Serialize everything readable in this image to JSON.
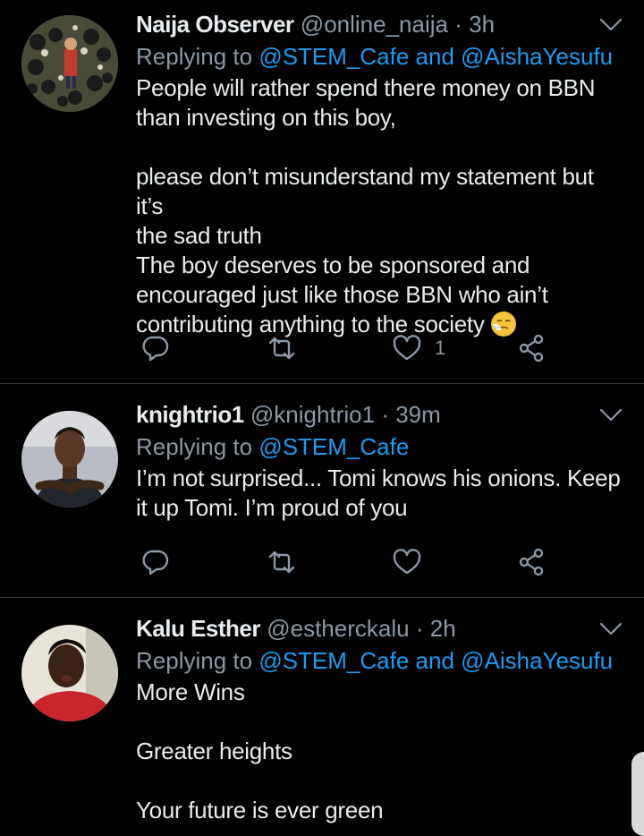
{
  "colors": {
    "background": "#000000",
    "text": "#e8ecef",
    "secondary": "#8b98a5",
    "mention": "#1d9bf0",
    "divider": "#2f3336"
  },
  "tweets": [
    {
      "name": "Naija Observer",
      "handle": "@online_naija",
      "separator": "·",
      "time": "3h",
      "replying_prefix": "Replying to",
      "replying_mentions": "@STEM_Cafe and @AishaYesufu",
      "body": "People will rather spend there money on BBN\nthan investing on this boy,\n\nplease don’t misunderstand my statement but it’s\nthe sad truth\nThe boy deserves to be sponsored and\nencouraged just like those BBN who ain’t\ncontributing anything to the society",
      "emoji": "sneezing-face-emoji",
      "like_count": "1",
      "icons": [
        "reply-icon",
        "retweet-icon",
        "like-icon",
        "share-icon",
        "chevron-down-icon"
      ]
    },
    {
      "name": "knightrio1",
      "handle": "@knightrio1",
      "separator": "·",
      "time": "39m",
      "replying_prefix": "Replying to",
      "replying_mentions": "@STEM_Cafe",
      "body": "I’m not surprised... Tomi knows his onions. Keep\nit up Tomi.  I’m proud of you",
      "like_count": "",
      "icons": [
        "reply-icon",
        "retweet-icon",
        "like-icon",
        "share-icon",
        "chevron-down-icon"
      ]
    },
    {
      "name": "Kalu Esther",
      "handle": "@estherckalu",
      "separator": "·",
      "time": "2h",
      "replying_prefix": "Replying to",
      "replying_mentions": "@STEM_Cafe and @AishaYesufu",
      "body": "More Wins\n\nGreater heights\n\nYour future is ever green",
      "icons": [
        "chevron-down-icon"
      ]
    }
  ]
}
